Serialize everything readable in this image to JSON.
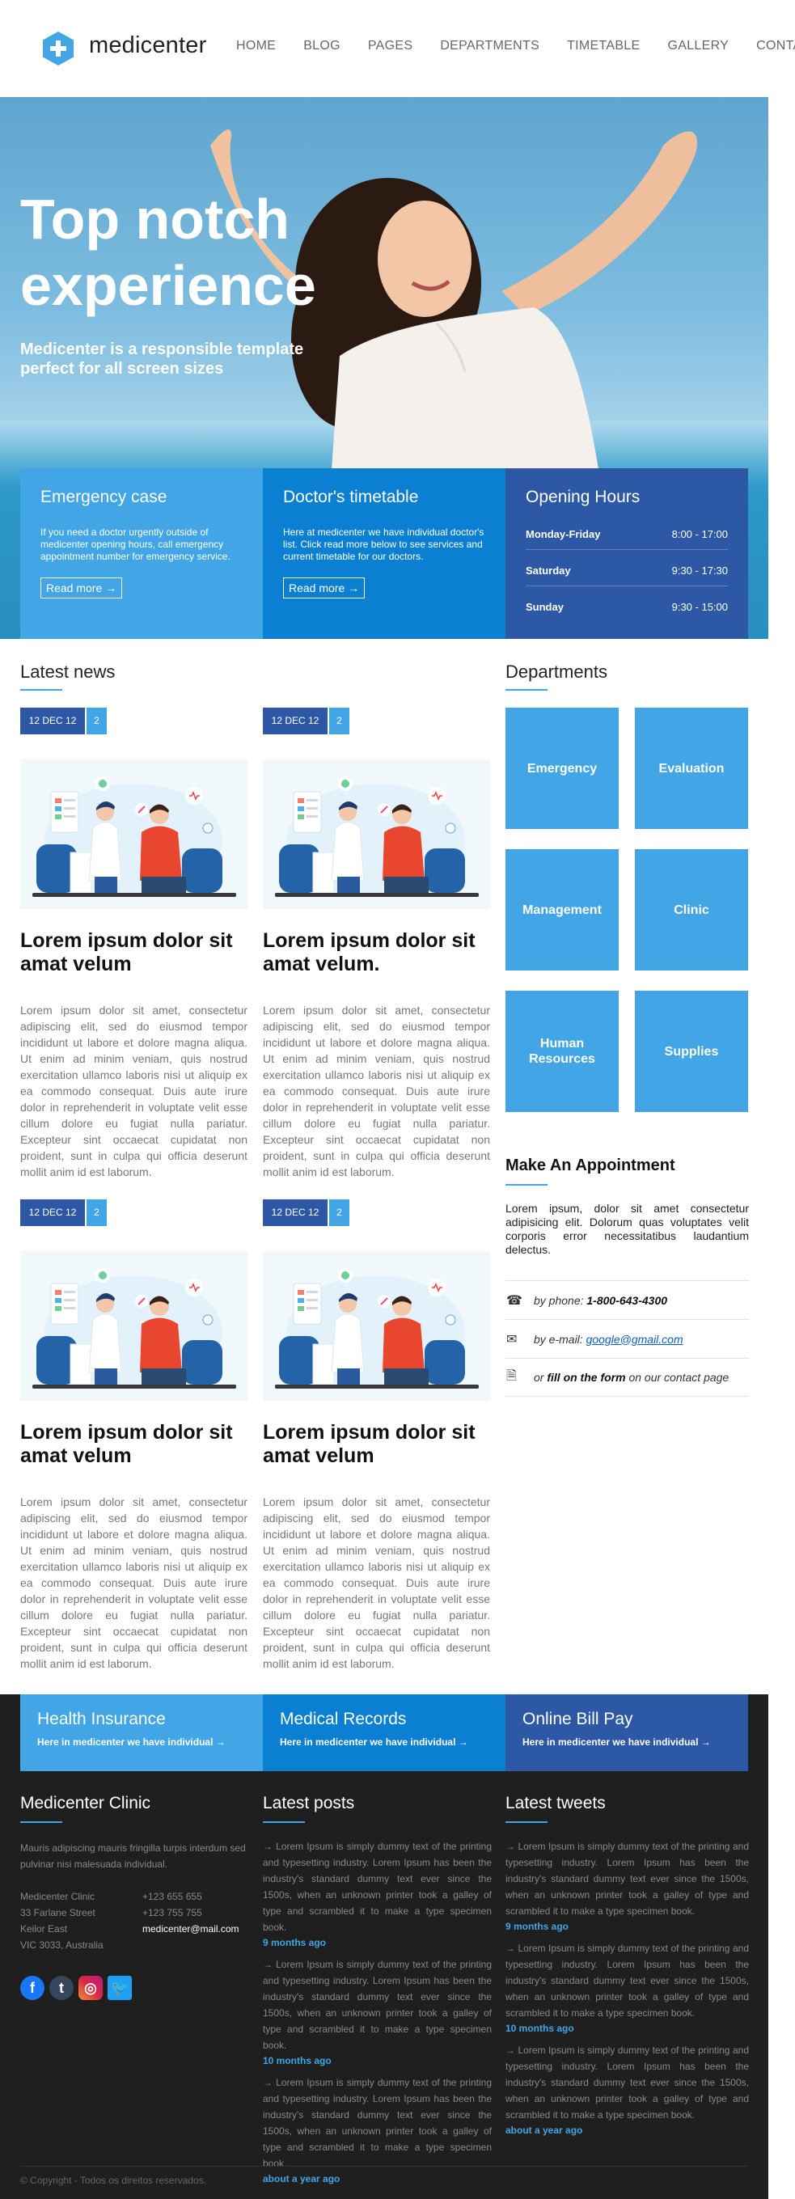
{
  "brand": {
    "name": "medicenter",
    "logo_icon": "plus-hexagon-icon",
    "accent": "#42a5e5",
    "dark_blue": "#2d58a6",
    "mid_blue": "#0b7fd1"
  },
  "nav": [
    "HOME",
    "BLOG",
    "PAGES",
    "DEPARTMENTS",
    "TIMETABLE",
    "GALLERY",
    "CONTACT"
  ],
  "hero": {
    "title": "Top notch experience",
    "subtitle": "Medicenter is a responsible template perfect for all screen sizes"
  },
  "info_boxes": {
    "emergency": {
      "title": "Emergency case",
      "text": "If you need a doctor urgently outside of medicenter opening hours, call emergency appointment number for emergency service.",
      "link": "Read more →"
    },
    "timetable": {
      "title": "Doctor's timetable",
      "text": "Here at medicenter we have individual doctor's list. Click read more below to see services and current timetable for our doctors.",
      "link": "Read more →"
    },
    "hours": {
      "title": "Opening Hours",
      "rows": [
        {
          "day": "Monday-Friday",
          "time": "8:00 - 17:00"
        },
        {
          "day": "Saturday",
          "time": "9:30 - 17:30"
        },
        {
          "day": "Sunday",
          "time": "9:30 - 15:00"
        }
      ]
    }
  },
  "news": {
    "title": "Latest news",
    "items": [
      {
        "date": "12 DEC 12",
        "comments": "2",
        "title": "Lorem ipsum dolor sit amat velum",
        "text": "Lorem ipsum dolor sit amet, consectetur adipiscing elit, sed do eiusmod tempor incididunt ut labore et dolore magna aliqua. Ut enim ad minim veniam, quis nostrud exercitation ullamco laboris nisi ut aliquip ex ea commodo consequat. Duis aute irure dolor in reprehenderit in voluptate velit esse cillum dolore eu fugiat nulla pariatur. Excepteur sint occaecat cupidatat non proident, sunt in culpa qui officia deserunt mollit anim id est laborum."
      },
      {
        "date": "12 DEC 12",
        "comments": "2",
        "title": "Lorem ipsum dolor sit amat velum.",
        "text": "Lorem ipsum dolor sit amet, consectetur adipiscing elit, sed do eiusmod tempor incididunt ut labore et dolore magna aliqua. Ut enim ad minim veniam, quis nostrud exercitation ullamco laboris nisi ut aliquip ex ea commodo consequat. Duis aute irure dolor in reprehenderit in voluptate velit esse cillum dolore eu fugiat nulla pariatur. Excepteur sint occaecat cupidatat non proident, sunt in culpa qui officia deserunt mollit anim id est laborum."
      },
      {
        "date": "12 DEC 12",
        "comments": "2",
        "title": "Lorem ipsum dolor sit amat velum",
        "text": "Lorem ipsum dolor sit amet, consectetur adipiscing elit, sed do eiusmod tempor incididunt ut labore et dolore magna aliqua. Ut enim ad minim veniam, quis nostrud exercitation ullamco laboris nisi ut aliquip ex ea commodo consequat. Duis aute irure dolor in reprehenderit in voluptate velit esse cillum dolore eu fugiat nulla pariatur. Excepteur sint occaecat cupidatat non proident, sunt in culpa qui officia deserunt mollit anim id est laborum."
      },
      {
        "date": "12 DEC 12",
        "comments": "2",
        "title": "Lorem ipsum dolor sit amat velum",
        "text": "Lorem ipsum dolor sit amet, consectetur adipiscing elit, sed do eiusmod tempor incididunt ut labore et dolore magna aliqua. Ut enim ad minim veniam, quis nostrud exercitation ullamco laboris nisi ut aliquip ex ea commodo consequat. Duis aute irure dolor in reprehenderit in voluptate velit esse cillum dolore eu fugiat nulla pariatur. Excepteur sint occaecat cupidatat non proident, sunt in culpa qui officia deserunt mollit anim id est laborum."
      }
    ]
  },
  "departments": {
    "title": "Departments",
    "items": [
      "Emergency",
      "Evaluation",
      "Management",
      "Clinic",
      "Human Resources",
      "Supplies"
    ]
  },
  "appointment": {
    "title": "Make An Appointment",
    "text": "Lorem ipsum, dolor sit amet consectetur adipisicing elit. Dolorum quas voluptates velit corporis error necessitatibus laudantium delectus.",
    "phone_prefix": "by phone:",
    "phone": "1-800-643-4300",
    "email_prefix": "by e-mail:",
    "email": "google@gmail.com",
    "form_prefix": "or",
    "form_bold": "fill on the form",
    "form_suffix": "on our contact page"
  },
  "cta": [
    {
      "title": "Health Insurance",
      "link": "Here in medicenter we have individual →"
    },
    {
      "title": "Medical Records",
      "link": "Here in medicenter we have individual →"
    },
    {
      "title": "Online Bill Pay",
      "link": "Here in medicenter we have individual →"
    }
  ],
  "footer": {
    "clinic": {
      "title": "Medicenter Clinic",
      "text": "Mauris adipiscing mauris fringilla turpis interdum sed pulvinar nisi malesuada individual.",
      "address": [
        "Medicenter Clinic",
        "33 Farlane Street",
        "Keilor East",
        "VIC 3033, Australia"
      ],
      "phone1": "+123 655 655",
      "phone2": "+123 755 755",
      "email": "medicenter@mail.com",
      "social": [
        "facebook-icon",
        "tumblr-icon",
        "instagram-icon",
        "twitter-icon"
      ]
    },
    "posts": {
      "title": "Latest posts",
      "items": [
        {
          "text": "→ Lorem Ipsum is simply dummy text of the printing and typesetting industry. Lorem Ipsum has been the industry's standard dummy text ever since the 1500s, when an unknown printer took a galley of type and scrambled it to make a type specimen book.",
          "age": "9 months ago"
        },
        {
          "text": "→ Lorem Ipsum is simply dummy text of the printing and typesetting industry. Lorem Ipsum has been the industry's standard dummy text ever since the 1500s, when an unknown printer took a galley of type and scrambled it to make a type specimen book.",
          "age": "10 months ago"
        },
        {
          "text": "→ Lorem Ipsum is simply dummy text of the printing and typesetting industry. Lorem Ipsum has been the industry's standard dummy text ever since the 1500s, when an unknown printer took a galley of type and scrambled it to make a type specimen book.",
          "age": "about a year ago"
        }
      ]
    },
    "tweets": {
      "title": "Latest tweets",
      "items": [
        {
          "text": "→ Lorem Ipsum is simply dummy text of the printing and typesetting industry. Lorem Ipsum has been the industry's standard dummy text ever since the 1500s, when an unknown printer took a galley of type and scrambled it to make a type specimen book.",
          "age": "9 months ago"
        },
        {
          "text": "→ Lorem Ipsum is simply dummy text of the printing and typesetting industry. Lorem Ipsum has been the industry's standard dummy text ever since the 1500s, when an unknown printer took a galley of type and scrambled it to make a type specimen book.",
          "age": "10 months ago"
        },
        {
          "text": "→ Lorem Ipsum is simply dummy text of the printing and typesetting industry. Lorem Ipsum has been the industry's standard dummy text ever since the 1500s, when an unknown printer took a galley of type and scrambled it to make a type specimen book.",
          "age": "about a year ago"
        }
      ]
    },
    "copyright": "© Copyright - Todos os direitos reservados."
  }
}
